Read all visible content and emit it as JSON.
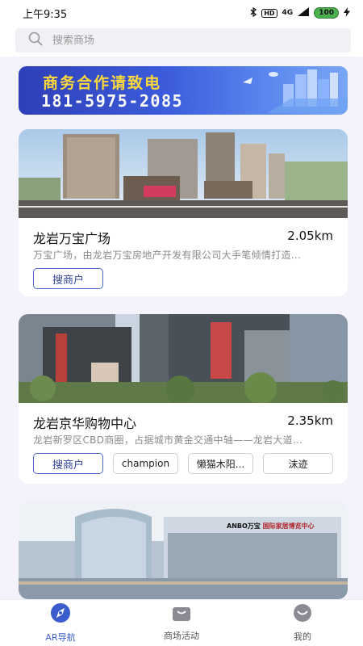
{
  "status_bar": {
    "time": "上午9:35",
    "hd": "HD",
    "network": "4G",
    "battery": "100"
  },
  "search": {
    "placeholder": "搜索商场"
  },
  "banner": {
    "title": "商务合作请致电",
    "phone": "181-5975-2085"
  },
  "malls": [
    {
      "name": "龙岩万宝广场",
      "distance": "2.05km",
      "description": "万宝广场，由龙岩万宝房地产开发有限公司大手笔倾情打造...",
      "tags": [
        "搜商户"
      ]
    },
    {
      "name": "龙岩京华购物中心",
      "distance": "2.35km",
      "description": "龙岩新罗区CBD商圈，占据城市黄金交通中轴——龙岩大道...",
      "tags": [
        "搜商户",
        "champion",
        "懒猫木阳...",
        "沫迹"
      ]
    },
    {
      "sign_brand": "ANBO万宝",
      "sign_text": "国际家居博览中心"
    }
  ],
  "bottom_nav": {
    "items": [
      {
        "label": "AR导航",
        "icon": "compass-icon",
        "active": true
      },
      {
        "label": "商场活动",
        "icon": "shopping-bag-icon",
        "active": false
      },
      {
        "label": "我的",
        "icon": "profile-icon",
        "active": false
      }
    ]
  },
  "colors": {
    "accent": "#3b5ccc",
    "banner_title": "#ffd83a",
    "background": "#f4f3fb"
  }
}
